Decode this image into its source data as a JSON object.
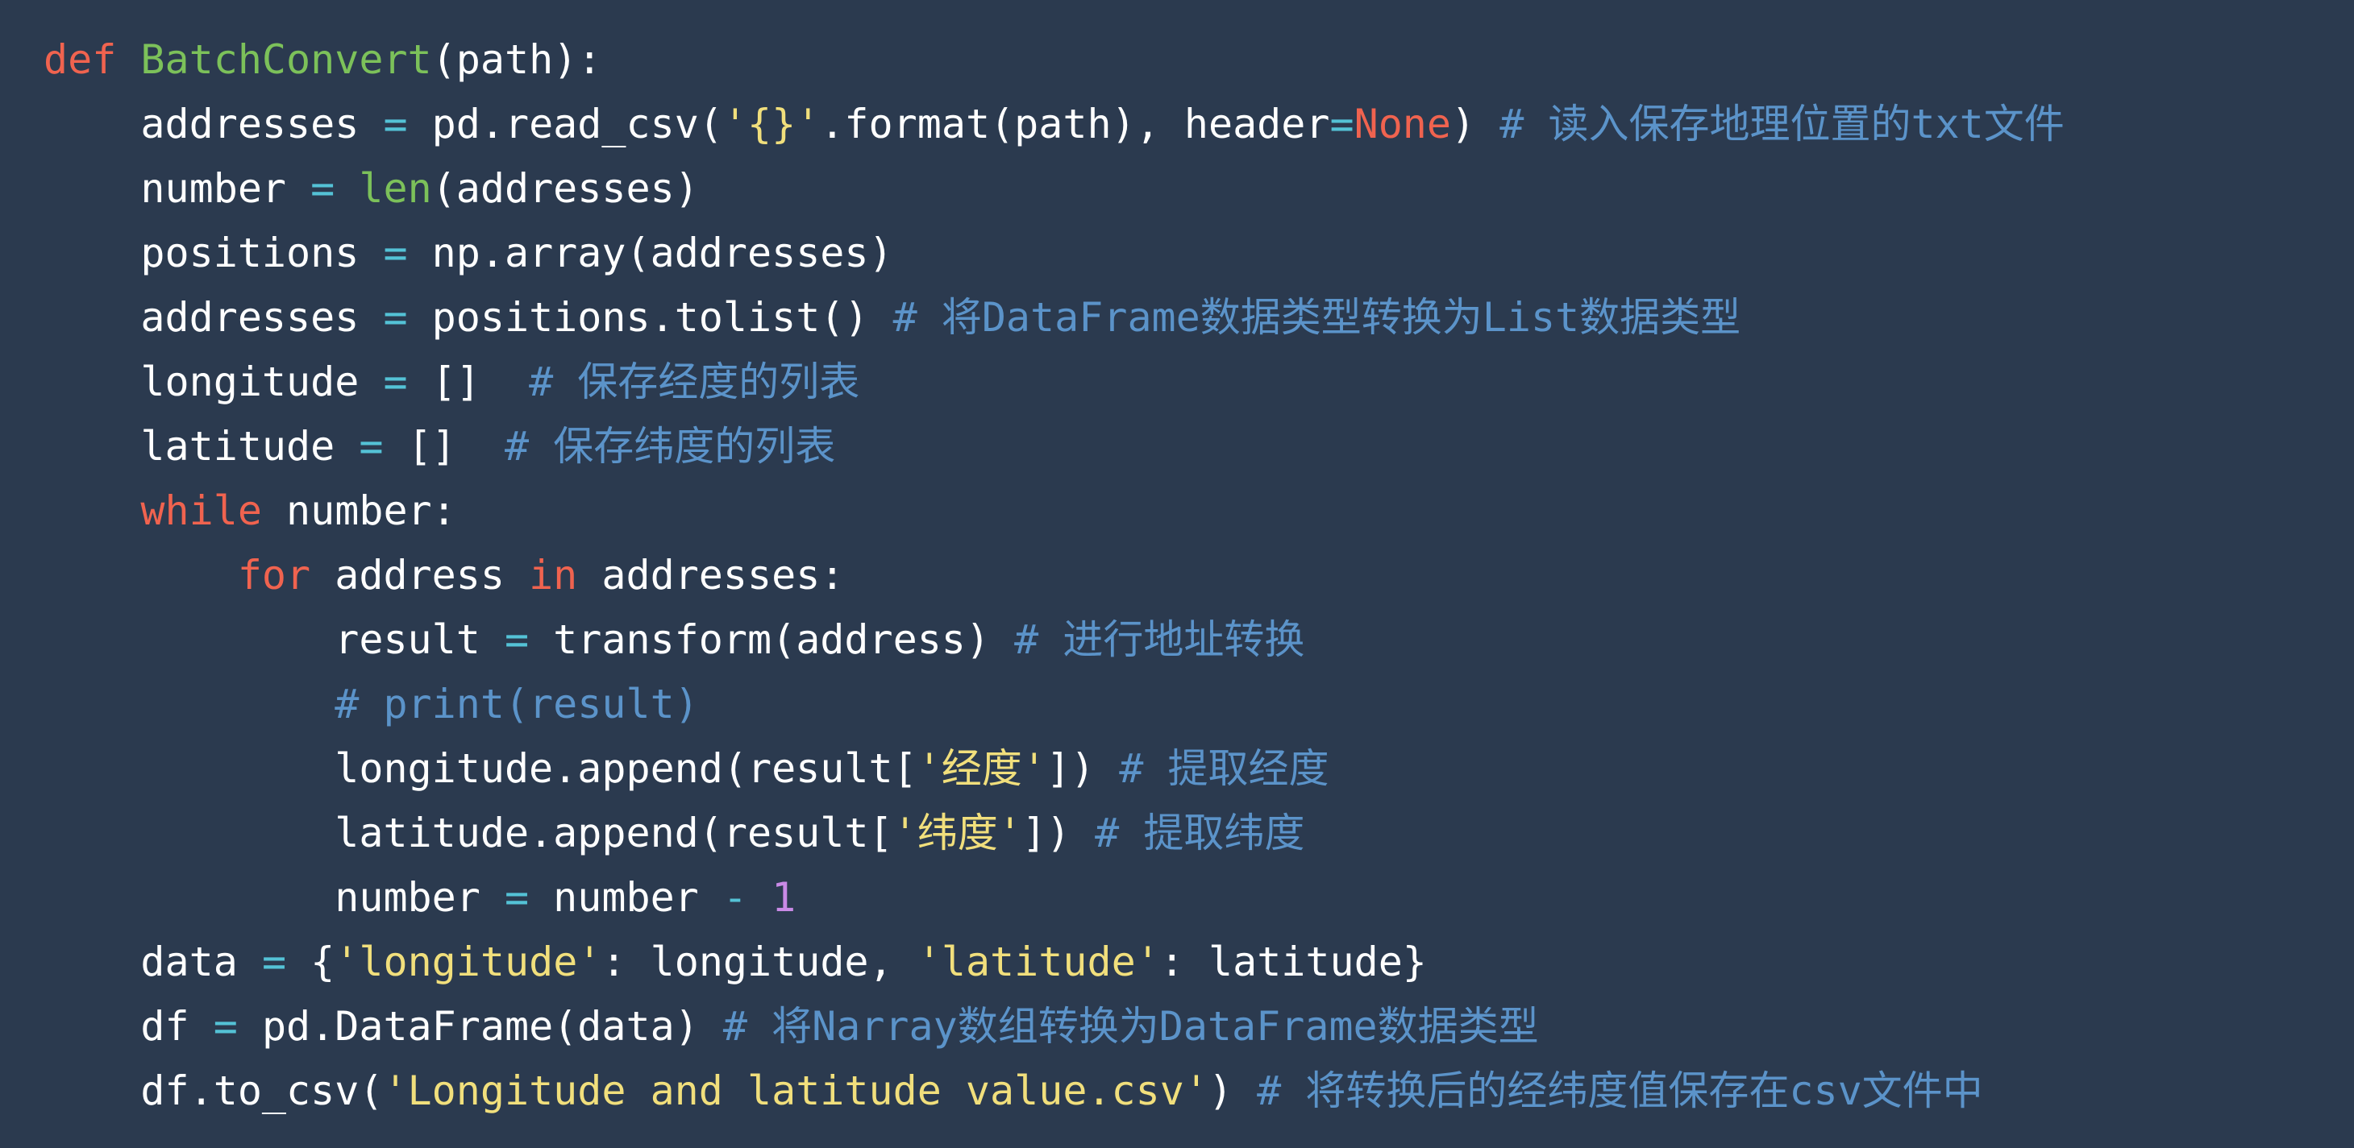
{
  "colors": {
    "background": "#2b3a4f",
    "plain": "#ffffff",
    "keyword": "#f0634f",
    "function": "#7cc15a",
    "operator": "#54c2d6",
    "string": "#f1df7c",
    "number": "#c98ae6",
    "comment": "#5b93c9"
  },
  "code_lines": [
    {
      "indent": "",
      "tokens": [
        {
          "t": "keyword",
          "v": "def"
        },
        {
          "t": "plain",
          "v": " "
        },
        {
          "t": "func",
          "v": "BatchConvert"
        },
        {
          "t": "plain",
          "v": "(path):"
        }
      ]
    },
    {
      "indent": "    ",
      "tokens": [
        {
          "t": "plain",
          "v": "addresses "
        },
        {
          "t": "op",
          "v": "="
        },
        {
          "t": "plain",
          "v": " pd.read_csv("
        },
        {
          "t": "string",
          "v": "'{}'"
        },
        {
          "t": "plain",
          "v": ".format(path), header"
        },
        {
          "t": "op",
          "v": "="
        },
        {
          "t": "const",
          "v": "None"
        },
        {
          "t": "plain",
          "v": ") "
        },
        {
          "t": "comment",
          "v": "# 读入保存地理位置的txt文件"
        }
      ]
    },
    {
      "indent": "    ",
      "tokens": [
        {
          "t": "plain",
          "v": "number "
        },
        {
          "t": "op",
          "v": "="
        },
        {
          "t": "plain",
          "v": " "
        },
        {
          "t": "builtin",
          "v": "len"
        },
        {
          "t": "plain",
          "v": "(addresses)"
        }
      ]
    },
    {
      "indent": "    ",
      "tokens": [
        {
          "t": "plain",
          "v": "positions "
        },
        {
          "t": "op",
          "v": "="
        },
        {
          "t": "plain",
          "v": " np.array(addresses)"
        }
      ]
    },
    {
      "indent": "    ",
      "tokens": [
        {
          "t": "plain",
          "v": "addresses "
        },
        {
          "t": "op",
          "v": "="
        },
        {
          "t": "plain",
          "v": " positions.tolist() "
        },
        {
          "t": "comment",
          "v": "# 将DataFrame数据类型转换为List数据类型"
        }
      ]
    },
    {
      "indent": "    ",
      "tokens": [
        {
          "t": "plain",
          "v": "longitude "
        },
        {
          "t": "op",
          "v": "="
        },
        {
          "t": "plain",
          "v": " []  "
        },
        {
          "t": "comment",
          "v": "# 保存经度的列表"
        }
      ]
    },
    {
      "indent": "    ",
      "tokens": [
        {
          "t": "plain",
          "v": "latitude "
        },
        {
          "t": "op",
          "v": "="
        },
        {
          "t": "plain",
          "v": " []  "
        },
        {
          "t": "comment",
          "v": "# 保存纬度的列表"
        }
      ]
    },
    {
      "indent": "    ",
      "tokens": [
        {
          "t": "keyword",
          "v": "while"
        },
        {
          "t": "plain",
          "v": " number:"
        }
      ]
    },
    {
      "indent": "        ",
      "tokens": [
        {
          "t": "keyword",
          "v": "for"
        },
        {
          "t": "plain",
          "v": " address "
        },
        {
          "t": "keyword",
          "v": "in"
        },
        {
          "t": "plain",
          "v": " addresses:"
        }
      ]
    },
    {
      "indent": "            ",
      "tokens": [
        {
          "t": "plain",
          "v": "result "
        },
        {
          "t": "op",
          "v": "="
        },
        {
          "t": "plain",
          "v": " transform(address) "
        },
        {
          "t": "comment",
          "v": "# 进行地址转换"
        }
      ]
    },
    {
      "indent": "            ",
      "tokens": [
        {
          "t": "comment",
          "v": "# print(result)"
        }
      ]
    },
    {
      "indent": "            ",
      "tokens": [
        {
          "t": "plain",
          "v": "longitude.append(result["
        },
        {
          "t": "string",
          "v": "'经度'"
        },
        {
          "t": "plain",
          "v": "]) "
        },
        {
          "t": "comment",
          "v": "# 提取经度"
        }
      ]
    },
    {
      "indent": "            ",
      "tokens": [
        {
          "t": "plain",
          "v": "latitude.append(result["
        },
        {
          "t": "string",
          "v": "'纬度'"
        },
        {
          "t": "plain",
          "v": "]) "
        },
        {
          "t": "comment",
          "v": "# 提取纬度"
        }
      ]
    },
    {
      "indent": "            ",
      "tokens": [
        {
          "t": "plain",
          "v": "number "
        },
        {
          "t": "op",
          "v": "="
        },
        {
          "t": "plain",
          "v": " number "
        },
        {
          "t": "op",
          "v": "-"
        },
        {
          "t": "plain",
          "v": " "
        },
        {
          "t": "number",
          "v": "1"
        }
      ]
    },
    {
      "indent": "    ",
      "tokens": [
        {
          "t": "plain",
          "v": "data "
        },
        {
          "t": "op",
          "v": "="
        },
        {
          "t": "plain",
          "v": " {"
        },
        {
          "t": "string",
          "v": "'longitude'"
        },
        {
          "t": "plain",
          "v": ": longitude, "
        },
        {
          "t": "string",
          "v": "'latitude'"
        },
        {
          "t": "plain",
          "v": ": latitude}"
        }
      ]
    },
    {
      "indent": "    ",
      "tokens": [
        {
          "t": "plain",
          "v": "df "
        },
        {
          "t": "op",
          "v": "="
        },
        {
          "t": "plain",
          "v": " pd.DataFrame(data) "
        },
        {
          "t": "comment",
          "v": "# 将Narray数组转换为DataFrame数据类型"
        }
      ]
    },
    {
      "indent": "    ",
      "tokens": [
        {
          "t": "plain",
          "v": "df.to_csv("
        },
        {
          "t": "string",
          "v": "'Longitude and latitude value.csv'"
        },
        {
          "t": "plain",
          "v": ") "
        },
        {
          "t": "comment",
          "v": "# 将转换后的经纬度值保存在csv文件中"
        }
      ]
    }
  ]
}
